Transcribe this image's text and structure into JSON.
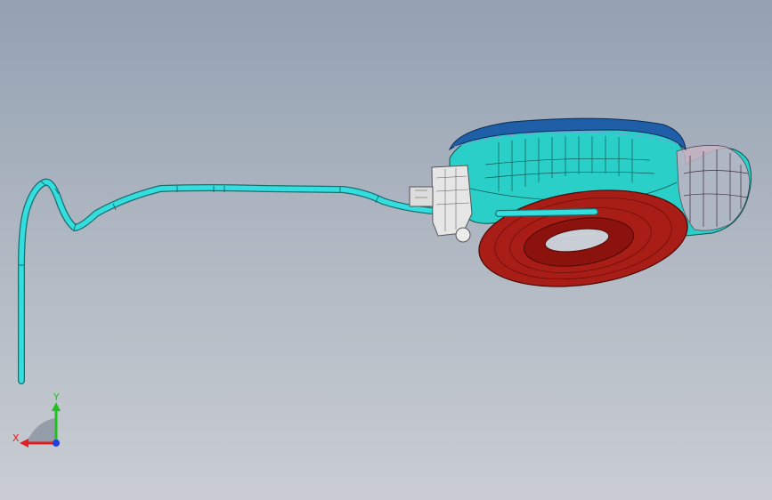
{
  "viewport": {
    "background_top": "#93a1b2",
    "background_bottom": "#c9cdd3"
  },
  "model": {
    "tube_color": "#35dede",
    "housing_color": "#2ad0c8",
    "cover_color": "#1f5fa8",
    "ring_color": "#a81d16",
    "connector_color": "#e6e6e6"
  },
  "triad": {
    "x_label": "X",
    "y_label": "Y",
    "x_color": "#e02020",
    "y_color": "#20c020",
    "z_color": "#2040e0"
  }
}
